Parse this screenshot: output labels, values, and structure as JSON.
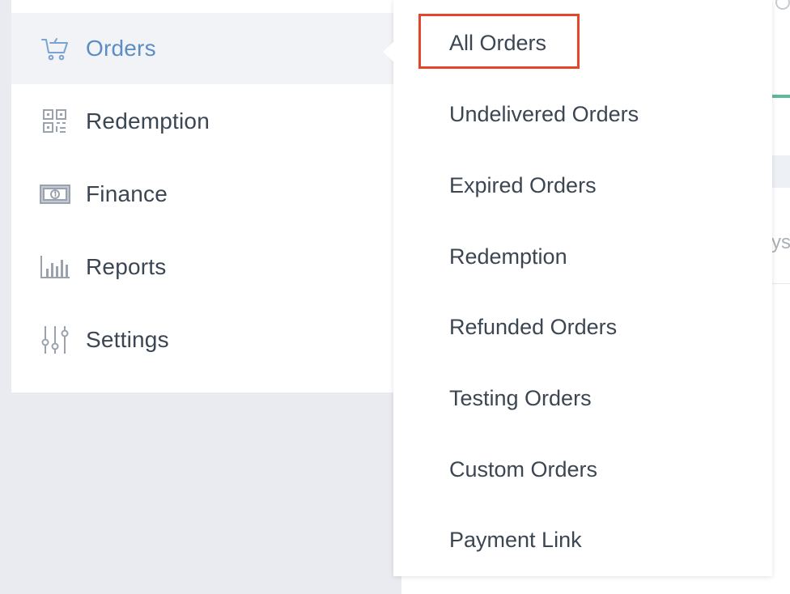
{
  "sidebar": {
    "items": [
      {
        "label": "Orders",
        "icon": "cart-icon",
        "active": true
      },
      {
        "label": "Redemption",
        "icon": "qr-code-icon",
        "active": false
      },
      {
        "label": "Finance",
        "icon": "banknote-icon",
        "active": false
      },
      {
        "label": "Reports",
        "icon": "bar-chart-icon",
        "active": false
      },
      {
        "label": "Settings",
        "icon": "sliders-icon",
        "active": false
      }
    ]
  },
  "submenu": {
    "items": [
      {
        "label": "All Orders",
        "highlighted": true
      },
      {
        "label": "Undelivered Orders"
      },
      {
        "label": "Expired Orders"
      },
      {
        "label": "Redemption"
      },
      {
        "label": "Refunded Orders"
      },
      {
        "label": "Testing Orders"
      },
      {
        "label": "Custom Orders"
      },
      {
        "label": "Payment Link"
      }
    ]
  },
  "background": {
    "partial_text": "ys"
  },
  "colors": {
    "active_text": "#5b8ec4",
    "text": "#3c4653",
    "icon": "#9aa3ad",
    "highlight": "#e5452b",
    "accent_green": "#5fb99a"
  }
}
